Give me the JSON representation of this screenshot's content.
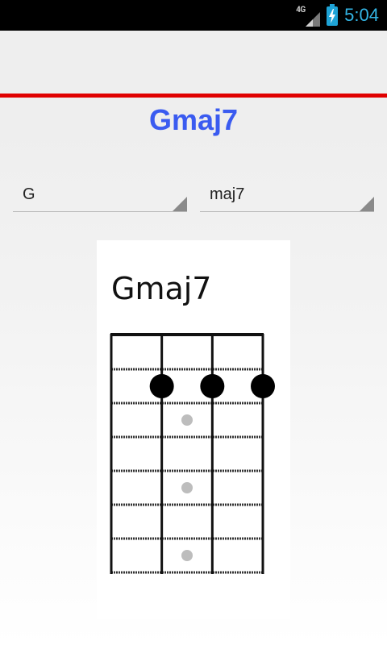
{
  "status_bar": {
    "network_type": "4G",
    "time": "5:04",
    "signal_icon": "signal-icon",
    "battery_icon": "battery-charging-icon"
  },
  "chord": {
    "title": "Gmaj7"
  },
  "selectors": {
    "root": {
      "value": "G"
    },
    "quality": {
      "value": "maj7"
    }
  },
  "diagram": {
    "title": "Gmaj7",
    "strings": 4,
    "frets": 7,
    "finger_positions": [
      {
        "string": 2,
        "fret": 2
      },
      {
        "string": 3,
        "fret": 2
      },
      {
        "string": 4,
        "fret": 2
      }
    ],
    "fret_markers": [
      3,
      5,
      7
    ]
  },
  "colors": {
    "accent_red": "#e00000",
    "title_blue": "#3a5bf0",
    "status_blue": "#33b5e5"
  }
}
